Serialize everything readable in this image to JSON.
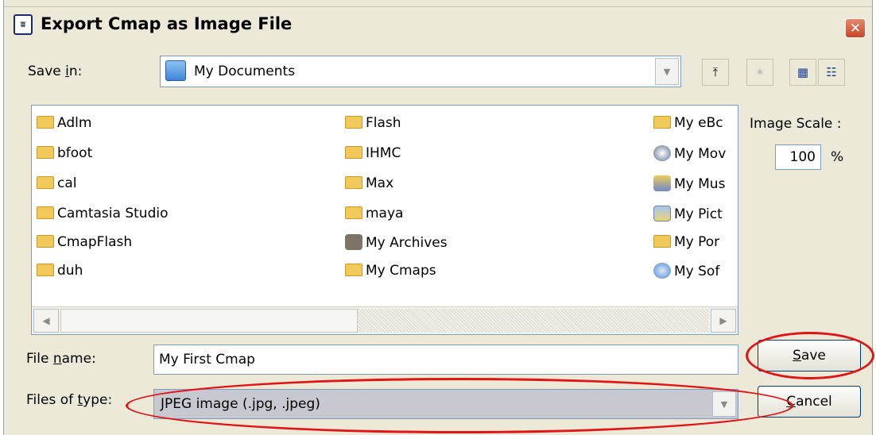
{
  "window": {
    "title": "Export Cmap as Image File",
    "app_icon": "cmap-app-icon",
    "close_glyph": "✕"
  },
  "save_in": {
    "label": "Save in:",
    "value": "My Documents"
  },
  "toolbar": {
    "up_icon": "up-one-level-icon",
    "new_folder_icon": "new-folder-icon",
    "list_view_icon": "list-view-icon",
    "details_view_icon": "details-view-icon"
  },
  "files": {
    "col1": [
      "Adlm",
      "bfoot",
      "cal",
      "Camtasia Studio",
      "CmapFlash",
      "duh"
    ],
    "col2": [
      "Flash",
      "IHMC",
      "Max",
      "maya",
      "My Archives",
      "My Cmaps"
    ],
    "col3": [
      "My eBc",
      "My Mov",
      "My Mus",
      "My Pict",
      "My Por",
      "My Sof"
    ]
  },
  "image_scale": {
    "label": "Image Scale :",
    "value": "100",
    "unit": "%"
  },
  "file_name": {
    "label": "File name:",
    "value": "My First Cmap"
  },
  "file_type": {
    "label": "Files of type:",
    "value": "JPEG image (.jpg, .jpeg)"
  },
  "buttons": {
    "save": "Save",
    "cancel": "Cancel"
  },
  "colors": {
    "highlight": "#e01515",
    "dialog_bg": "#ece9d8"
  }
}
